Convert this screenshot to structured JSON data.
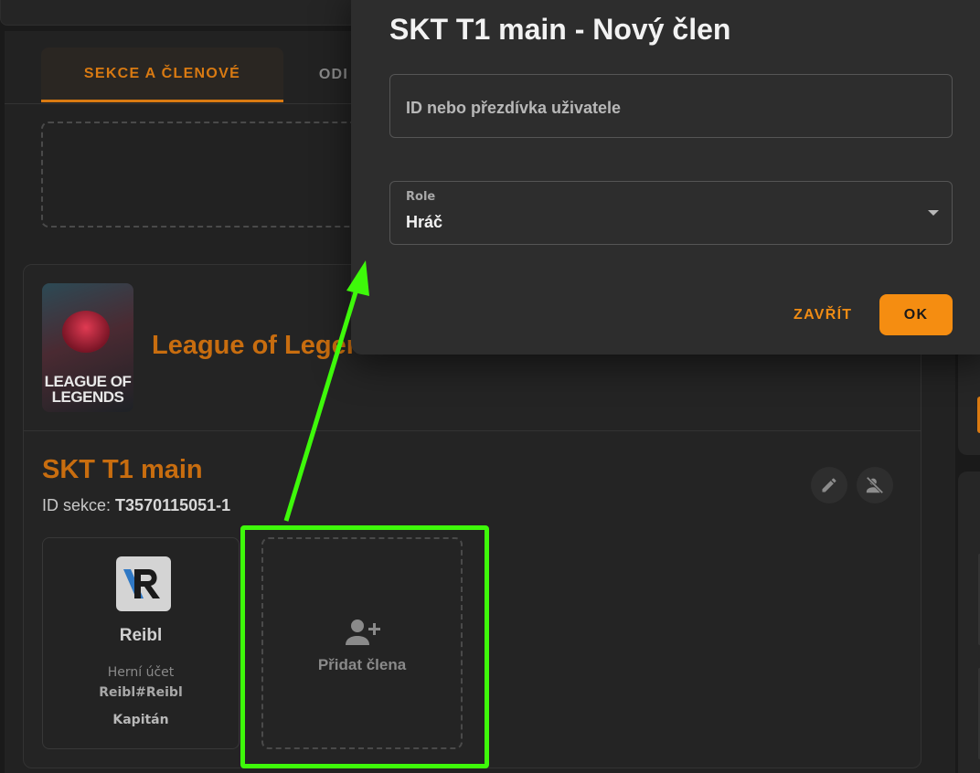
{
  "tabs": [
    {
      "label": "SEKCE A ČLENOVÉ",
      "active": true
    },
    {
      "label": "ODI",
      "active": false
    }
  ],
  "game": {
    "title": "League of Legends",
    "cover_logo_line1": "LEAGUE OF",
    "cover_logo_line2": "LEGENDS"
  },
  "section": {
    "title": "SKT T1 main",
    "id_label": "ID sekce:",
    "id_value": "T3570115051-1",
    "edit_icon": "pencil-icon",
    "remove_icon": "remove-person-icon"
  },
  "members": [
    {
      "name": "Reibl",
      "account_label": "Herní účet",
      "account": "Reibl#Reibl",
      "role": "Kapitán",
      "avatar_icon": "reibl-logo"
    }
  ],
  "add_member": {
    "label": "Přidat člena",
    "icon": "add-person-icon"
  },
  "dialog": {
    "title": "SKT T1 main - Nový člen",
    "id_field_placeholder": "ID nebo přezdívka uživatele",
    "role_label": "Role",
    "role_value": "Hráč",
    "close_label": "ZAVŘÍT",
    "ok_label": "OK"
  },
  "colors": {
    "accent": "#f58d11",
    "title_orange": "#c86d0f",
    "highlight_green": "#3ef90a"
  }
}
